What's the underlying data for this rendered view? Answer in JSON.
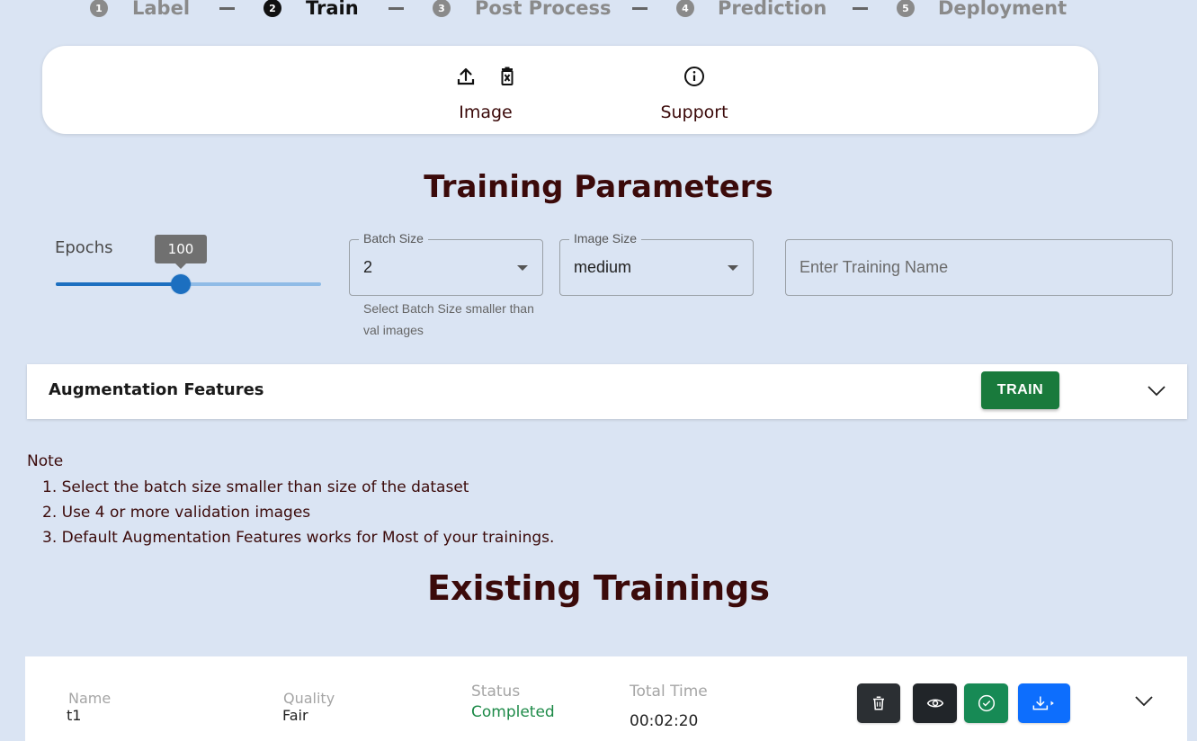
{
  "stepper": {
    "steps": [
      {
        "num": "1",
        "label": "Label"
      },
      {
        "num": "2",
        "label": "Train"
      },
      {
        "num": "3",
        "label": "Post Process"
      },
      {
        "num": "4",
        "label": "Prediction"
      },
      {
        "num": "5",
        "label": "Deployment"
      }
    ],
    "active": "Train"
  },
  "toolbar": {
    "image_label": "Image",
    "support_label": "Support"
  },
  "training_parameters": {
    "title": "Training Parameters",
    "epochs": {
      "label": "Epochs",
      "value": "100",
      "fraction": 0.47
    },
    "batch_size": {
      "label": "Batch Size",
      "value": "2",
      "helper": "Select Batch Size smaller than val images"
    },
    "image_size": {
      "label": "Image Size",
      "value": "medium"
    },
    "training_name": {
      "placeholder": "Enter Training Name",
      "value": ""
    }
  },
  "augmentation": {
    "title": "Augmentation Features",
    "train_button": "TRAIN"
  },
  "notes": {
    "heading": "Note",
    "items": [
      "1. Select the batch size smaller than size of the dataset",
      "2. Use 4 or more validation images",
      "3. Default Augmentation Features works for Most of your trainings."
    ]
  },
  "existing": {
    "title": "Existing Trainings",
    "headers": {
      "name": "Name",
      "quality": "Quality",
      "status": "Status",
      "time": "Total Time"
    },
    "rows": [
      {
        "name": "t1",
        "quality": "Fair",
        "status": "Completed",
        "time": "00:02:20"
      }
    ]
  },
  "colors": {
    "background": "#dae4f3",
    "title": "#3b0a0a",
    "accent": "#1c6fc0",
    "train_green": "#197a3c",
    "status_green": "#1d8a48",
    "delete_btn": "#2b2f33",
    "view_btn": "#212529",
    "approve_btn": "#178a55",
    "download_btn": "#0d6efd"
  }
}
